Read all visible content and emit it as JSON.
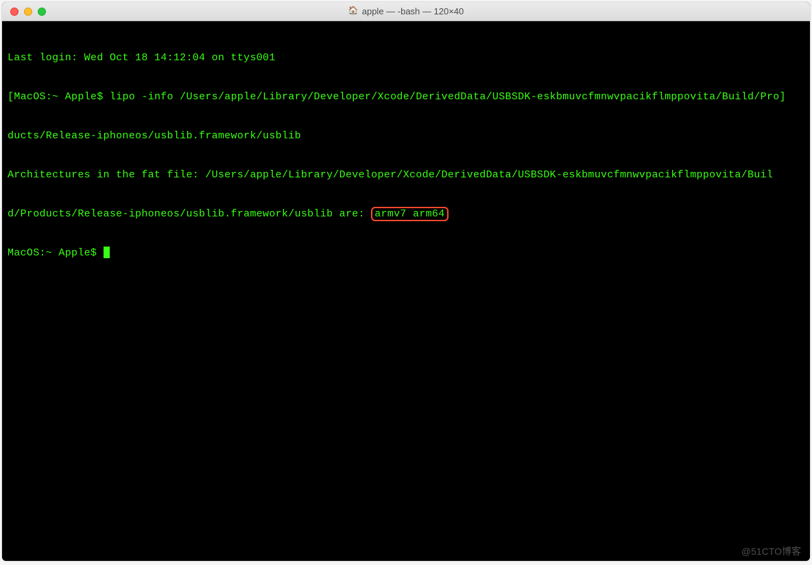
{
  "titlebar": {
    "title": "apple — -bash — 120×40"
  },
  "terminal": {
    "last_login": "Last login: Wed Oct 18 14:12:04 on ttys001",
    "prompt_open": "[",
    "prompt_host": "MacOS:~ Apple$ ",
    "command1": "lipo -info /Users/apple/Library/Developer/Xcode/DerivedData/USBSDK-eskbmuvcfmnwvpacikflmppovita/Build/Pro",
    "command1_close": "]",
    "command1_wrap": "ducts/Release-iphoneos/usblib.framework/usblib",
    "output_line1": "Architectures in the fat file: /Users/apple/Library/Developer/Xcode/DerivedData/USBSDK-eskbmuvcfmnwvpacikflmppovita/Buil",
    "output_line2_prefix": "d/Products/Release-iphoneos/usblib.framework/usblib are: ",
    "output_highlight": "armv7 arm64",
    "prompt2": "MacOS:~ Apple$ "
  },
  "watermark": "@51CTO博客"
}
